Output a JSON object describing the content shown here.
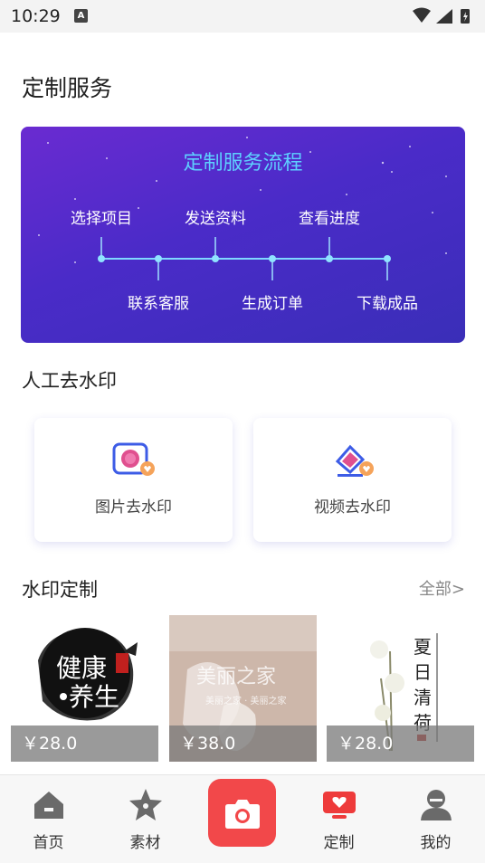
{
  "status_bar": {
    "time": "10:29",
    "notif_badge": "A"
  },
  "page": {
    "title": "定制服务"
  },
  "process": {
    "title": "定制服务流程",
    "steps": [
      "选择项目",
      "联系客服",
      "发送资料",
      "生成订单",
      "查看进度",
      "下载成品"
    ],
    "title_color": "#5ed0ff"
  },
  "watermark_removal": {
    "title": "人工去水印",
    "items": [
      {
        "label": "图片去水印",
        "icon": "image-erase-icon"
      },
      {
        "label": "视频去水印",
        "icon": "video-erase-icon"
      }
    ]
  },
  "watermark_custom": {
    "title": "水印定制",
    "more": "全部>",
    "products": [
      {
        "price": "￥28.0",
        "image": "健康养生"
      },
      {
        "price": "￥38.0",
        "image": "美丽之家"
      },
      {
        "price": "￥28.0",
        "image": "夏日清荷"
      }
    ]
  },
  "bottom_nav": {
    "items": [
      {
        "label": "首页",
        "icon": "home-icon"
      },
      {
        "label": "素材",
        "icon": "star-icon"
      },
      {
        "label": "",
        "icon": "camera-icon"
      },
      {
        "label": "定制",
        "icon": "custom-heart-icon"
      },
      {
        "label": "我的",
        "icon": "profile-icon"
      }
    ],
    "active": "定制",
    "active_color": "#ee3b3b",
    "camera_color": "#f2484a"
  }
}
